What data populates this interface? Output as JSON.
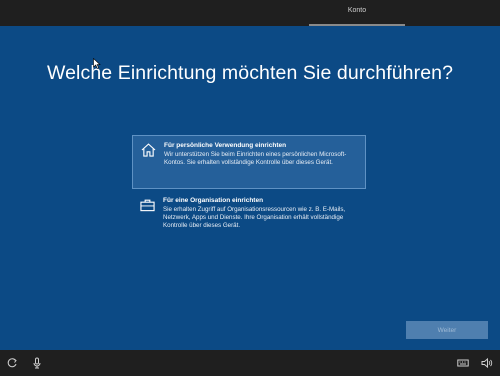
{
  "header": {
    "tab_label": "Konto"
  },
  "main": {
    "title": "Welche Einrichtung möchten Sie durchführen?",
    "options": [
      {
        "icon": "home-icon",
        "title": "Für persönliche Verwendung einrichten",
        "description": "Wir unterstützen Sie beim Einrichten eines persönlichen Microsoft-Kontos. Sie erhalten vollständige Kontrolle über dieses Gerät.",
        "selected": true
      },
      {
        "icon": "briefcase-icon",
        "title": "Für eine Organisation einrichten",
        "description": "Sie erhalten Zugriff auf Organisationsressourcen wie z. B. E-Mails, Netzwerk, Apps und Dienste. Ihre Organisation erhält vollständige Kontrolle über dieses Gerät.",
        "selected": false
      }
    ],
    "next_label": "Weiter"
  },
  "colors": {
    "background": "#0c4a85",
    "selected_option": "#25609a",
    "button": "#4f7faf",
    "bars": "#1f1f1f"
  },
  "bottom_bar": {
    "icons": [
      "ease-of-access-icon",
      "microphone-icon",
      "keyboard-icon",
      "volume-icon"
    ]
  }
}
